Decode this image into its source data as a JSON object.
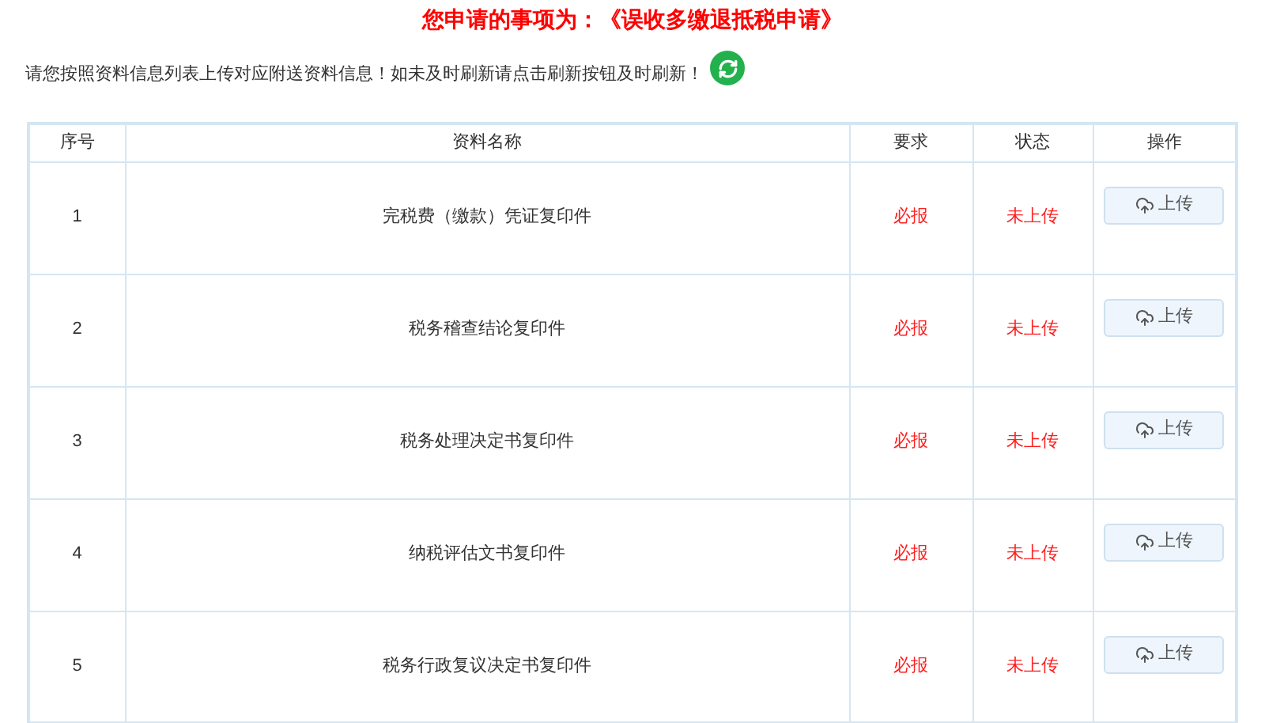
{
  "title": "您申请的事项为：《误收多缴退抵税申请》",
  "instruction": "请您按照资料信息列表上传对应附送资料信息！如未及时刷新请点击刷新按钮及时刷新！",
  "table": {
    "columns": [
      "序号",
      "资料名称",
      "要求",
      "状态",
      "操作"
    ],
    "rows": [
      {
        "index": "1",
        "name": "完税费（缴款）凭证复印件",
        "requirement": "必报",
        "status": "未上传",
        "action": "上传"
      },
      {
        "index": "2",
        "name": "税务稽查结论复印件",
        "requirement": "必报",
        "status": "未上传",
        "action": "上传"
      },
      {
        "index": "3",
        "name": "税务处理决定书复印件",
        "requirement": "必报",
        "status": "未上传",
        "action": "上传"
      },
      {
        "index": "4",
        "name": "纳税评估文书复印件",
        "requirement": "必报",
        "status": "未上传",
        "action": "上传"
      },
      {
        "index": "5",
        "name": "税务行政复议决定书复印件",
        "requirement": "必报",
        "status": "未上传",
        "action": "上传"
      }
    ]
  }
}
